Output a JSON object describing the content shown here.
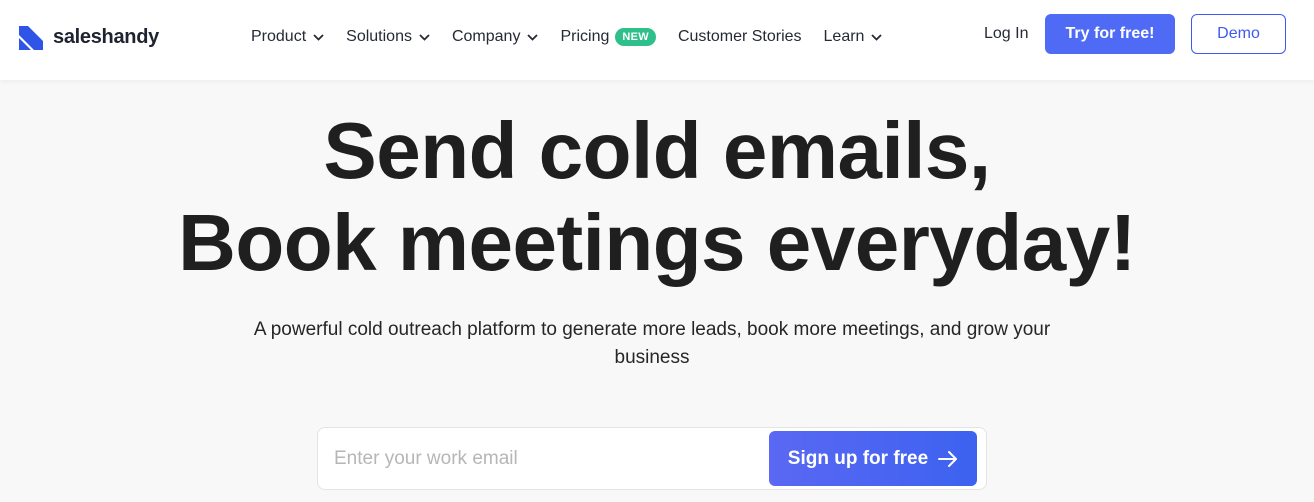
{
  "brand": {
    "name": "saleshandy",
    "accent": "#4f6bf5",
    "logo_color": "#2f55e8"
  },
  "nav": {
    "items": [
      {
        "label": "Product",
        "has_dropdown": true
      },
      {
        "label": "Solutions",
        "has_dropdown": true
      },
      {
        "label": "Company",
        "has_dropdown": true
      },
      {
        "label": "Pricing",
        "badge": "NEW"
      },
      {
        "label": "Customer Stories"
      },
      {
        "label": "Learn",
        "has_dropdown": true
      }
    ],
    "login_label": "Log In",
    "try_label": "Try for free!",
    "demo_label": "Demo",
    "badge_color": "#2fbf8a"
  },
  "hero": {
    "title_line1": "Send cold emails,",
    "title_line2": "Book meetings everyday!",
    "subtitle": "A powerful cold outreach platform to generate more leads, book more meetings, and grow your business"
  },
  "signup": {
    "email_value": "",
    "email_placeholder": "Enter your work email",
    "button_label": "Sign up for free",
    "button_icon": "arrow-right-icon"
  }
}
